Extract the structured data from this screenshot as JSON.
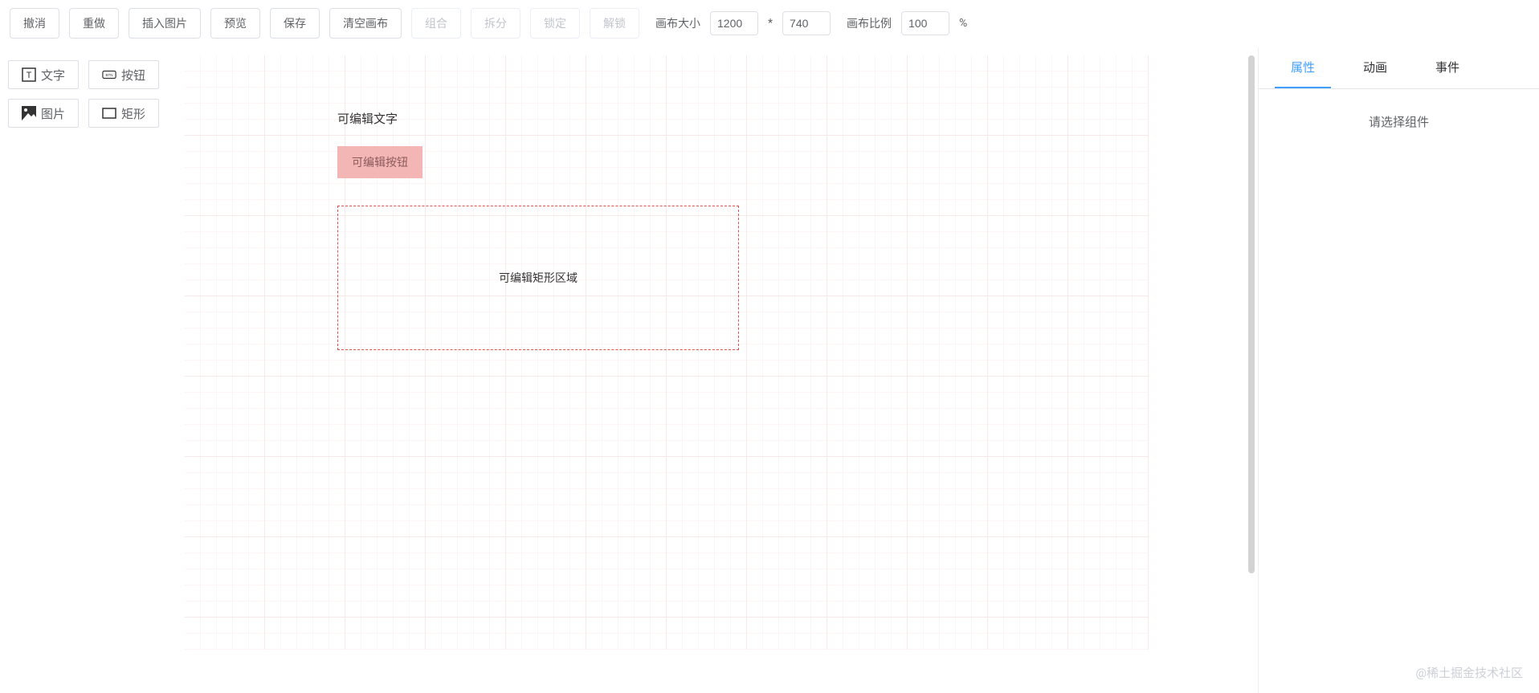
{
  "toolbar": {
    "undo": "撤消",
    "redo": "重做",
    "insertImage": "插入图片",
    "preview": "预览",
    "save": "保存",
    "clearCanvas": "清空画布",
    "group": "组合",
    "ungroup": "拆分",
    "lock": "锁定",
    "unlock": "解锁",
    "canvasSizeLabel": "画布大小",
    "canvasWidth": "1200",
    "canvasHeight": "740",
    "canvasSep": "*",
    "canvasScaleLabel": "画布比例",
    "canvasScale": "100",
    "canvasScaleUnit": "%"
  },
  "palette": {
    "text": "文字",
    "button": "按钮",
    "image": "图片",
    "rect": "矩形"
  },
  "canvas": {
    "textContent": "可编辑文字",
    "buttonContent": "可编辑按钮",
    "rectContent": "可编辑矩形区域"
  },
  "sidebar": {
    "tabs": {
      "properties": "属性",
      "animation": "动画",
      "events": "事件"
    },
    "placeholder": "请选择组件"
  },
  "watermark": "@稀土掘金技术社区"
}
